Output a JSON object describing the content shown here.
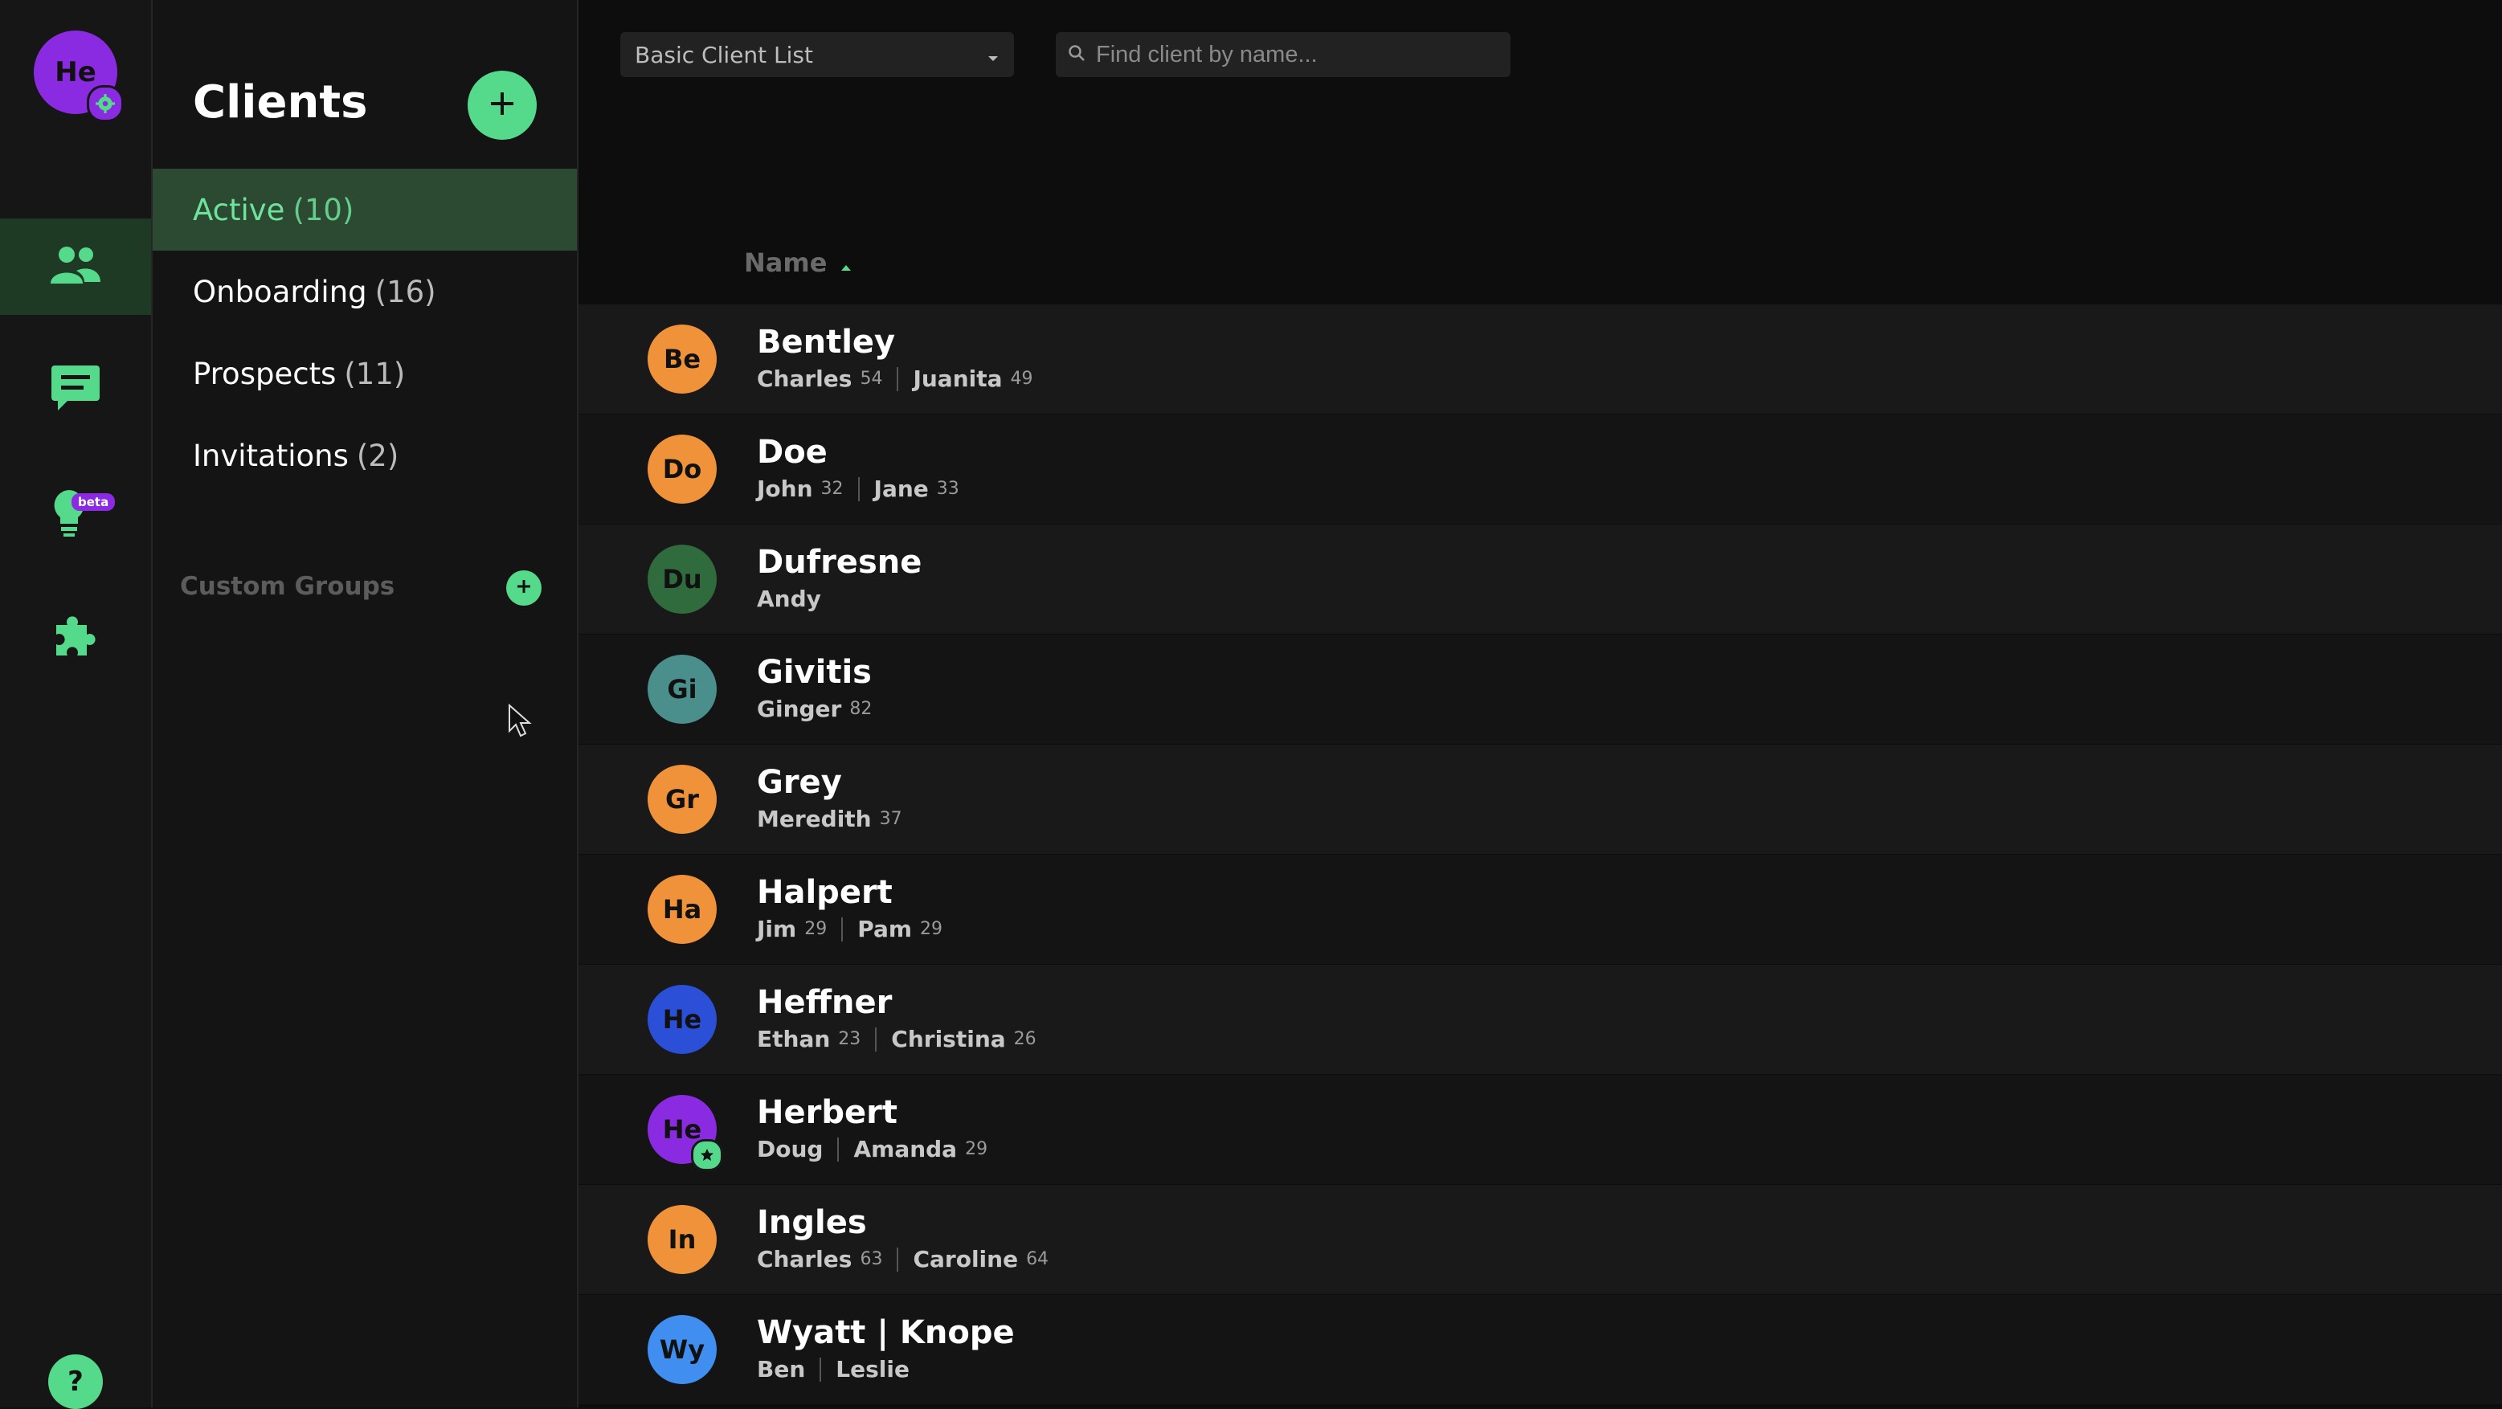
{
  "rail": {
    "avatar_initials": "He",
    "beta_label": "beta",
    "help_label": "?"
  },
  "sidebar": {
    "title": "Clients",
    "items": [
      {
        "label": "Active",
        "count": "(10)"
      },
      {
        "label": "Onboarding",
        "count": "(16)"
      },
      {
        "label": "Prospects",
        "count": "(11)"
      },
      {
        "label": "Invitations",
        "count": "(2)"
      }
    ],
    "custom_groups_label": "Custom Groups"
  },
  "toolbar": {
    "view_select": "Basic Client List",
    "search_placeholder": "Find client by name..."
  },
  "table": {
    "column_name": "Name",
    "rows": [
      {
        "initials": "Be",
        "color": "#f0923a",
        "name": "Bentley",
        "m1": "Charles",
        "a1": "54",
        "m2": "Juanita",
        "a2": "49"
      },
      {
        "initials": "Do",
        "color": "#f0923a",
        "name": "Doe",
        "m1": "John",
        "a1": "32",
        "m2": "Jane",
        "a2": "33"
      },
      {
        "initials": "Du",
        "color": "#2f6b3d",
        "name": "Dufresne",
        "m1": "Andy",
        "a1": "",
        "m2": "",
        "a2": ""
      },
      {
        "initials": "Gi",
        "color": "#4a8f8c",
        "name": "Givitis",
        "m1": "Ginger",
        "a1": "82",
        "m2": "",
        "a2": ""
      },
      {
        "initials": "Gr",
        "color": "#f0923a",
        "name": "Grey",
        "m1": "Meredith",
        "a1": "37",
        "m2": "",
        "a2": ""
      },
      {
        "initials": "Ha",
        "color": "#f0923a",
        "name": "Halpert",
        "m1": "Jim",
        "a1": "29",
        "m2": "Pam",
        "a2": "29"
      },
      {
        "initials": "He",
        "color": "#2b4fd6",
        "name": "Heffner",
        "m1": "Ethan",
        "a1": "23",
        "m2": "Christina",
        "a2": "26"
      },
      {
        "initials": "He",
        "color": "#8a2be2",
        "name": "Herbert",
        "m1": "Doug",
        "a1": "",
        "m2": "Amanda",
        "a2": "29",
        "starred": true
      },
      {
        "initials": "In",
        "color": "#f0923a",
        "name": "Ingles",
        "m1": "Charles",
        "a1": "63",
        "m2": "Caroline",
        "a2": "64"
      },
      {
        "initials": "Wy",
        "color": "#3f8ef0",
        "name": "Wyatt | Knope",
        "m1": "Ben",
        "a1": "",
        "m2": "Leslie",
        "a2": ""
      }
    ]
  },
  "colors": {
    "accent": "#55d98a",
    "active_bg": "#2b4a31"
  }
}
